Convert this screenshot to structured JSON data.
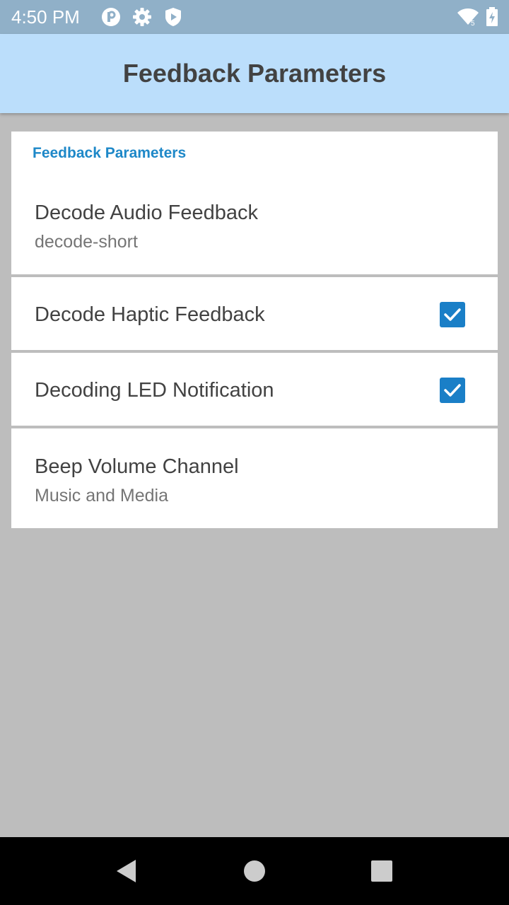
{
  "status_bar": {
    "time": "4:50 PM",
    "left_icons": [
      "p-badge-icon",
      "gear-icon",
      "shield-play-icon"
    ],
    "right_icons": [
      "wifi-icon",
      "battery-charging-icon"
    ]
  },
  "app_bar": {
    "title": "Feedback Parameters"
  },
  "preferences": {
    "section_header": "Feedback Parameters",
    "items": [
      {
        "title": "Decode Audio Feedback",
        "summary": "decode-short"
      },
      {
        "title": "Decode Haptic Feedback",
        "checked": true
      },
      {
        "title": "Decoding LED Notification",
        "checked": true
      },
      {
        "title": "Beep Volume Channel",
        "summary": "Music and Media"
      }
    ]
  },
  "nav_bar": {
    "buttons": [
      "back-icon",
      "home-icon",
      "recents-icon"
    ]
  },
  "colors": {
    "app_bar_bg": "#bbdefb",
    "accent": "#1a7fc7",
    "page_bg": "#bdbdbd",
    "status_bar_bg": "#90b0c8"
  }
}
